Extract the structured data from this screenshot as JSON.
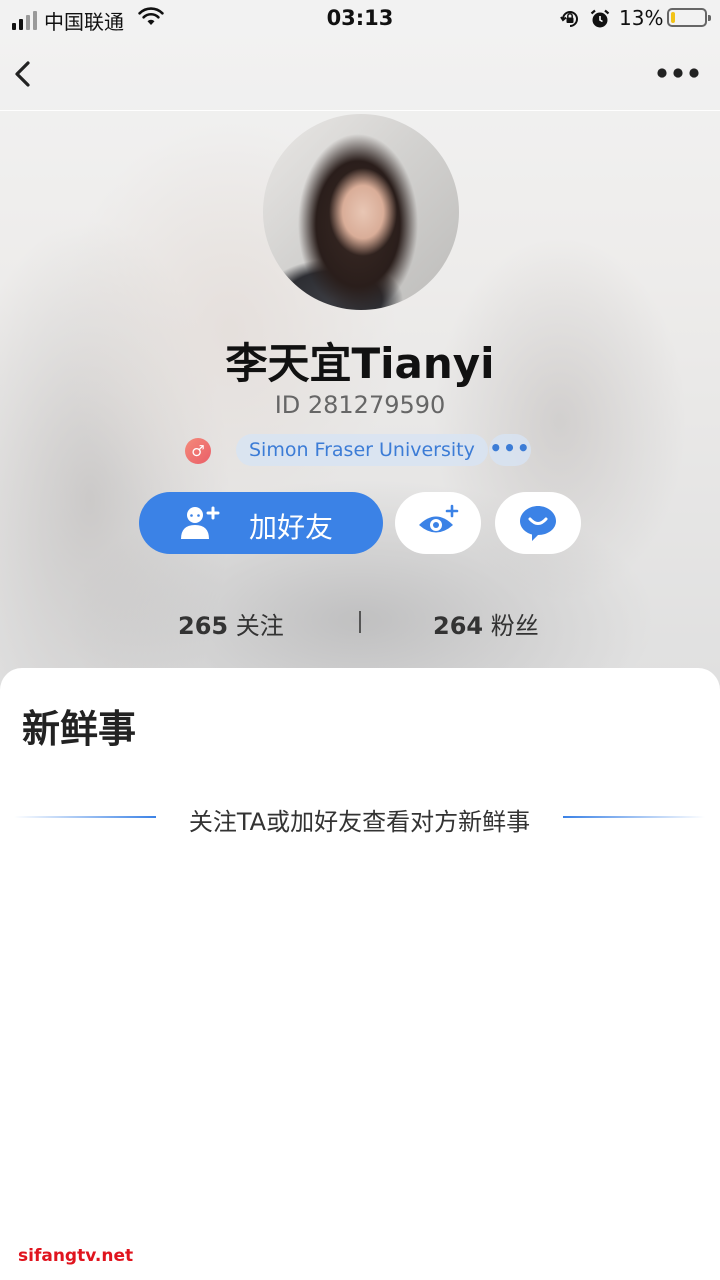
{
  "status_bar": {
    "carrier": "中国联通",
    "time": "03:13",
    "battery_percent": "13%",
    "battery_level": 0.13,
    "signal_bars": 2,
    "icons": [
      "signal-icon",
      "wifi-icon",
      "rotation-lock-icon",
      "alarm-icon",
      "battery-icon"
    ]
  },
  "nav": {
    "back_icon": "chevron-left-icon",
    "more_icon": "more-horizontal-icon"
  },
  "profile": {
    "name": "李天宜Tianyi",
    "id_text": "ID 281279590",
    "gender_symbol": "♂",
    "school": "Simon Fraser University",
    "tags_more": "•••"
  },
  "actions": {
    "add_friend_label": "加好友",
    "accent_color": "#3b82e6"
  },
  "stats": {
    "following_count": "265",
    "following_label": "关注",
    "fans_count": "264",
    "fans_label": "粉丝"
  },
  "feed": {
    "title": "新鲜事",
    "hint": "关注TA或加好友查看对方新鲜事"
  },
  "watermark": "sifangtv.net"
}
